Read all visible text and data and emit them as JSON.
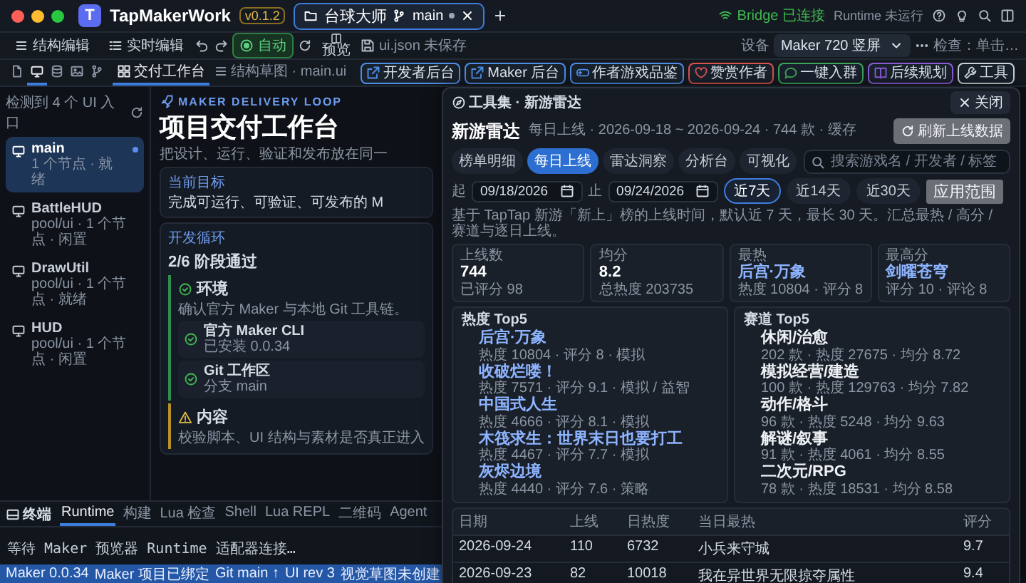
{
  "window": {
    "logo_letter": "T",
    "app_name": "TapMakerWork",
    "version": "v0.1.2",
    "tabs": [
      {
        "title": "台球大师",
        "branch": "main",
        "modified": true,
        "selected": true
      }
    ],
    "bridge_status": "Bridge 已连接",
    "runtime_status": "Runtime 未运行"
  },
  "toolbar": {
    "edit_modes": [
      "结构编辑",
      "实时编辑"
    ],
    "auto": {
      "label": "自动",
      "on": true
    },
    "preview_label": "预览",
    "file_status": "ui.json 未保存",
    "links": [
      {
        "label": "开发者后台",
        "kind": "external",
        "color": "#4d8fe8"
      },
      {
        "label": "Maker 后台",
        "kind": "external",
        "color": "#4d8fe8"
      },
      {
        "label": "作者游戏品鉴",
        "kind": "game",
        "color": "#4d8fe8"
      },
      {
        "label": "赞赏作者",
        "kind": "heart",
        "color": "#d9534f"
      },
      {
        "label": "一键入群",
        "kind": "chat",
        "color": "#3fa35b"
      },
      {
        "label": "后续规划",
        "kind": "book",
        "color": "#8b5cd6"
      },
      {
        "label": "工具",
        "kind": "tool",
        "color": "#c9d1d9"
      }
    ],
    "device_label": "设备",
    "device": "Maker 720 竖屏",
    "inspect_hint": "检查：单击…"
  },
  "panel_tabs": [
    {
      "selected": false
    },
    {
      "selected": true
    },
    {
      "selected": false
    },
    {
      "selected": false
    },
    {
      "selected": false
    }
  ],
  "editor_tabs": [
    {
      "label": "交付工作台",
      "selected": true
    },
    {
      "label": "结构草图 · main.ui",
      "selected": false
    }
  ],
  "sidebar": {
    "header": "检测到 4 个 UI 入口",
    "items": [
      {
        "name": "main",
        "meta": "1 个节点 · 就绪",
        "selected": true,
        "modified": true
      },
      {
        "name": "BattleHUD",
        "meta": "pool/ui · 1 个节点 · 闲置",
        "selected": false,
        "modified": false
      },
      {
        "name": "DrawUtil",
        "meta": "pool/ui · 1 个节点 · 就绪",
        "selected": false,
        "modified": false
      },
      {
        "name": "HUD",
        "meta": "pool/ui · 1 个节点 · 闲置",
        "selected": false,
        "modified": false
      }
    ]
  },
  "workbench": {
    "eyebrow": "MAKER DELIVERY LOOP",
    "title": "项目交付工作台",
    "description": "把设计、运行、验证和发布放在同一",
    "goal": {
      "label": "当前目标",
      "text": "完成可运行、可验证、可发布的 M"
    },
    "loop": {
      "label": "开发循环",
      "progress": "2/6 阶段通过",
      "stages": [
        {
          "kind": "done",
          "title": "环境",
          "description": "确认官方 Maker 与本地 Git 工具链。",
          "checks": [
            {
              "title": "官方 Maker CLI",
              "detail": "已安装 0.0.34",
              "passed": true
            },
            {
              "title": "Git 工作区",
              "detail": "分支 main",
              "passed": true
            }
          ]
        },
        {
          "kind": "warning",
          "title": "内容",
          "description": "校验脚本、UI 结构与素材是否真正进入"
        }
      ]
    }
  },
  "bottom_panel": {
    "title": "终端",
    "tabs": [
      {
        "label": "Runtime",
        "selected": true
      },
      {
        "label": "构建",
        "selected": false
      },
      {
        "label": "Lua 检查",
        "selected": false
      },
      {
        "label": "Shell",
        "selected": false
      },
      {
        "label": "Lua REPL",
        "selected": false
      },
      {
        "label": "二维码",
        "selected": false
      },
      {
        "label": "Agent",
        "selected": false
      }
    ],
    "output": "等待 Maker 预览器 Runtime 适配器连接…"
  },
  "status_bar": [
    "Maker 0.0.34",
    "Maker 项目已绑定",
    "Git main ↑",
    "UI rev 3",
    "视觉草图未创建"
  ],
  "modal": {
    "title": "工具集 · 新游雷达",
    "close": "关闭",
    "heading": "新游雷达",
    "summary": "每日上线 · 2026-09-18 ~ 2026-09-24 · 744 款 · 缓存",
    "refresh": "刷新上线数据",
    "tabs": [
      {
        "label": "榜单明细",
        "selected": false
      },
      {
        "label": "每日上线",
        "selected": true
      },
      {
        "label": "雷达洞察",
        "selected": false
      },
      {
        "label": "分析台",
        "selected": false
      },
      {
        "label": "可视化",
        "selected": false
      }
    ],
    "search": {
      "placeholder": "搜索游戏名 / 开发者 / 标签"
    },
    "range": {
      "from_label": "起",
      "from": "09/18/2026",
      "to_label": "止",
      "to": "09/24/2026",
      "presets": [
        {
          "label": "近7天",
          "selected": true
        },
        {
          "label": "近14天",
          "selected": false
        },
        {
          "label": "近30天",
          "selected": false
        }
      ],
      "apply": "应用范围"
    },
    "note": "基于 TapTap 新游「新上」榜的上线时间，默认近 7 天，最长 30 天。汇总最热 / 高分 / 赛道与逐日上线。",
    "stats": [
      {
        "label": "上线数",
        "value": "744",
        "detail": "已评分 98",
        "kind": "number"
      },
      {
        "label": "均分",
        "value": "8.2",
        "detail": "总热度 203735",
        "kind": "number"
      },
      {
        "label": "最热",
        "value": "后宫·万象",
        "detail": "热度 10804 · 评分 8",
        "kind": "game"
      },
      {
        "label": "最高分",
        "value": "剑曜苍穹",
        "detail": "评分 10 · 评论 8",
        "kind": "game"
      }
    ],
    "hot_top5": {
      "title": "热度 Top5",
      "kind": "game",
      "items": [
        {
          "name": "后宫·万象",
          "detail": "热度 10804 · 评分 8 · 模拟"
        },
        {
          "name": "收破烂喽！",
          "detail": "热度 7571 · 评分 9.1 · 模拟 / 益智"
        },
        {
          "name": "中国式人生",
          "detail": "热度 4666 · 评分 8.1 · 模拟"
        },
        {
          "name": "木筏求生：世界末日也要打工",
          "detail": "热度 4467 · 评分 7.7 · 模拟"
        },
        {
          "name": "灰烬边境",
          "detail": "热度 4440 · 评分 7.6 · 策略"
        }
      ]
    },
    "genre_top5": {
      "title": "赛道 Top5",
      "kind": "genre",
      "items": [
        {
          "name": "休闲/治愈",
          "detail": "202 款 · 热度 27675 · 均分 8.72"
        },
        {
          "name": "模拟经营/建造",
          "detail": "100 款 · 热度 129763 · 均分 7.82"
        },
        {
          "name": "动作/格斗",
          "detail": "96 款 · 热度 5248 · 均分 9.63"
        },
        {
          "name": "解谜/叙事",
          "detail": "91 款 · 热度 4061 · 均分 8.55"
        },
        {
          "name": "二次元/RPG",
          "detail": "78 款 · 热度 18531 · 均分 8.58"
        }
      ]
    },
    "table": {
      "columns": [
        "日期",
        "上线",
        "日热度",
        "当日最热",
        "评分"
      ],
      "rows": [
        [
          "2026-09-24",
          "110",
          "6732",
          "小兵来守城",
          "9.7"
        ],
        [
          "2026-09-23",
          "82",
          "10018",
          "我在异世界无限掠夺属性",
          "9.4"
        ]
      ]
    }
  }
}
